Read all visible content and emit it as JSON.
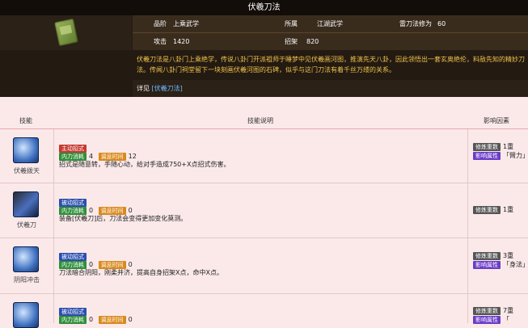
{
  "title": "伏羲刀法",
  "info": {
    "grade_label": "品阶",
    "grade_value": "上乘武学",
    "school_label": "所属",
    "school_value": "江湖武学",
    "power_label": "雷刀法修为",
    "power_value": "60",
    "attack_label": "攻击",
    "attack_value": "1420",
    "parry_label": "招架",
    "parry_value": "820"
  },
  "description": "伏羲刀法是八卦门上乘绝学，传说八卦门开派祖师于睡梦中见伏羲画河图，推演先天八卦，因此领悟出一套玄奥绝伦，料敌先知的精妙刀法。传闻八卦门祠堂留下一块刻画伏羲河图的石碑，似乎与这门刀法有着千丝万缕的关系。",
  "detail": {
    "label": "详见",
    "link": "[伏羲刀法]"
  },
  "table": {
    "header": {
      "col1": "技能",
      "col2": "技能说明",
      "col3": "影响因素"
    },
    "rows": [
      {
        "name": "伏羲拨天",
        "type_tag": "主动招式",
        "inner_tag": "内力消耗",
        "inner_val": "4",
        "cd_tag": "调息时间",
        "cd_val": "12",
        "text": "招式是随意转，手随心动，给对手造成750+X点招式伤害。",
        "factors": [
          {
            "tag": "修炼重数",
            "val": "1重"
          },
          {
            "tag": "影响属性",
            "val": "「臂力」"
          }
        ]
      },
      {
        "name": "伏羲刀",
        "type_tag": "被动招式",
        "inner_tag": "内力消耗",
        "inner_val": "0",
        "cd_tag": "调息时间",
        "cd_val": "0",
        "text": "装备[伏羲刀]后，刀法会变得更加变化莫测。",
        "factors": [
          {
            "tag": "修炼重数",
            "val": "1重"
          }
        ]
      },
      {
        "name": "阴阳冲击",
        "type_tag": "被动招式",
        "inner_tag": "内力消耗",
        "inner_val": "0",
        "cd_tag": "调息时间",
        "cd_val": "0",
        "text": "刀法暗合阴阳，刚柔并济，提高自身招架X点，命中X点。",
        "factors": [
          {
            "tag": "修炼重数",
            "val": "3重"
          },
          {
            "tag": "影响属性",
            "val": "「身法」"
          }
        ]
      },
      {
        "name": "",
        "type_tag": "被动招式",
        "inner_tag": "内力消耗",
        "inner_val": "0",
        "cd_tag": "调息时间",
        "cd_val": "0",
        "text": "",
        "factors": [
          {
            "tag": "修炼重数",
            "val": "7重"
          },
          {
            "tag": "影响属性",
            "val": "「"
          }
        ]
      }
    ]
  }
}
